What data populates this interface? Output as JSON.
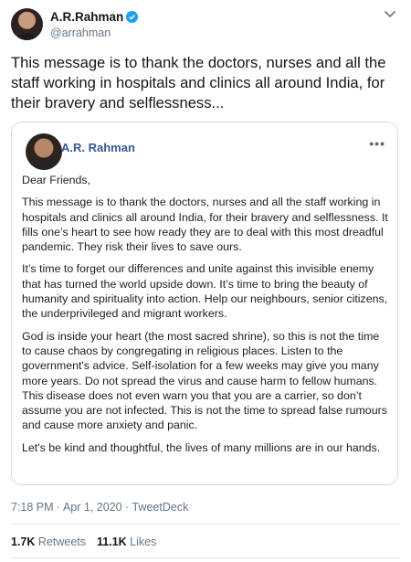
{
  "author": {
    "name": "A.R.Rahman",
    "handle": "@arrahman"
  },
  "tweet_text": "This message is to thank the doctors, nurses and all the staff working in hospitals and clinics all around India, for their bravery and selflessness...",
  "card": {
    "author_name": "A.R. Rahman",
    "more_label": "•••",
    "paragraphs": [
      "Dear Friends,",
      "This message is to thank the doctors, nurses and all the staff working in hospitals and clinics all around India, for their bravery and selflessness. It fills one’s heart to see how ready they are to deal with this most dreadful pandemic. They risk their lives to save ours.",
      "It’s time to forget our differences and unite against this invisible enemy that has turned the world upside down. It’s time to bring the beauty of humanity and spirituality into action. Help our neighbours, senior citizens, the underprivileged and migrant workers.",
      "God is inside your heart (the most sacred shrine), so this is not the time to cause chaos by congregating in religious places. Listen to the government's advice. Self-isolation for a few weeks may give you many more years. Do not spread the virus and cause harm to fellow humans. This disease does not even warn you that you are a carrier, so don’t assume you are not infected. This is not the time to spread false rumours and cause more anxiety and panic.",
      "Let's be kind and thoughtful, the lives of many millions are in our hands."
    ]
  },
  "meta": {
    "time_date": "7:18 PM · Apr 1, 2020 · ",
    "source": "TweetDeck"
  },
  "stats": {
    "retweets_count": "1.7K",
    "retweets_label": "Retweets",
    "likes_count": "11.1K",
    "likes_label": "Likes"
  },
  "colors": {
    "verified": "#1da1f2",
    "card_name": "#395898",
    "muted": "#657786"
  },
  "icons": {
    "verified": "verified-badge-icon",
    "caret": "chevron-down-icon",
    "more": "more-horizontal-icon"
  }
}
